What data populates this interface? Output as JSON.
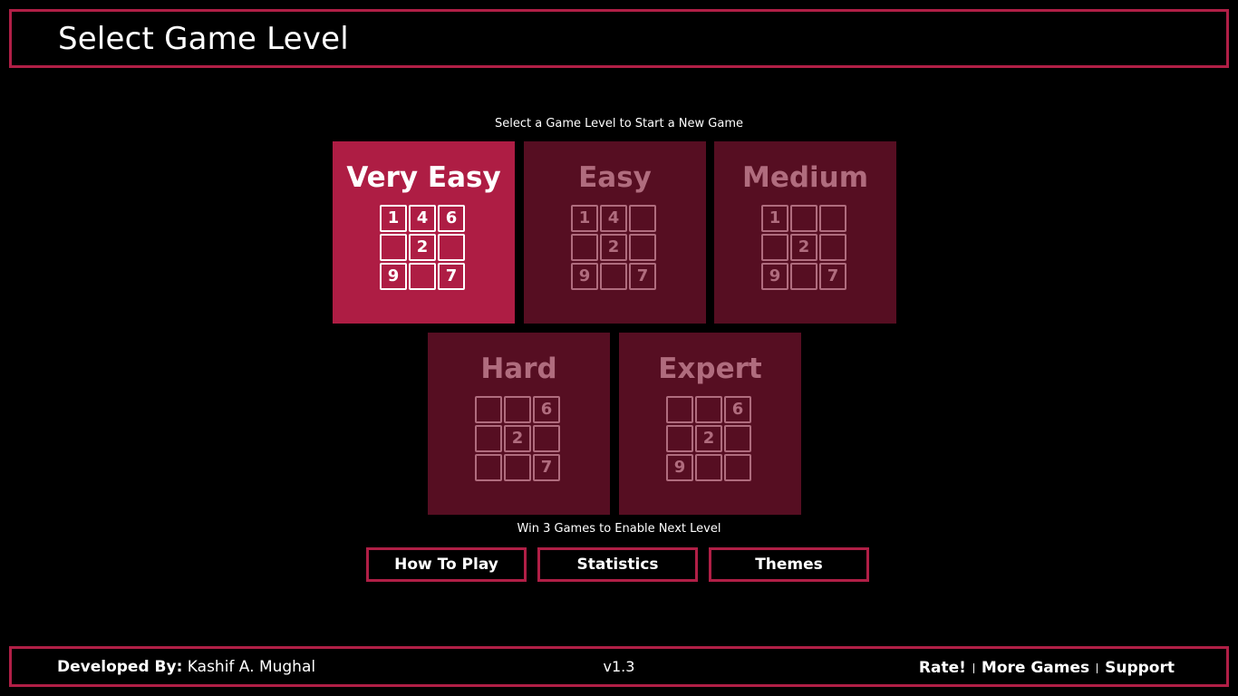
{
  "header": {
    "title": "Select Game Level"
  },
  "subtitle": "Select a Game Level to Start a New Game",
  "levels": [
    {
      "name": "Very Easy",
      "active": true,
      "cells": [
        "1",
        "4",
        "6",
        "",
        "2",
        "",
        "9",
        "",
        "7"
      ]
    },
    {
      "name": "Easy",
      "active": false,
      "cells": [
        "1",
        "4",
        "",
        "",
        "2",
        "",
        "9",
        "",
        "7"
      ]
    },
    {
      "name": "Medium",
      "active": false,
      "cells": [
        "1",
        "",
        "",
        "",
        "2",
        "",
        "9",
        "",
        "7"
      ]
    },
    {
      "name": "Hard",
      "active": false,
      "cells": [
        "",
        "",
        "6",
        "",
        "2",
        "",
        "",
        "",
        "7"
      ]
    },
    {
      "name": "Expert",
      "active": false,
      "cells": [
        "",
        "",
        "6",
        "",
        "2",
        "",
        "9",
        "",
        ""
      ]
    }
  ],
  "note": "Win 3 Games to Enable Next Level",
  "buttons": {
    "how_to_play": "How To Play",
    "statistics": "Statistics",
    "themes": "Themes"
  },
  "footer": {
    "developed_by_label": "Developed By:",
    "developer": "Kashif A. Mughal",
    "version": "v1.3",
    "links": {
      "rate": "Rate!",
      "more_games": "More Games",
      "support": "Support"
    }
  },
  "colors": {
    "accent": "#b01f46",
    "tile_active": "#ae1d44",
    "tile_locked": "#560e22",
    "locked_text": "#b06c7e",
    "background": "#000000"
  }
}
